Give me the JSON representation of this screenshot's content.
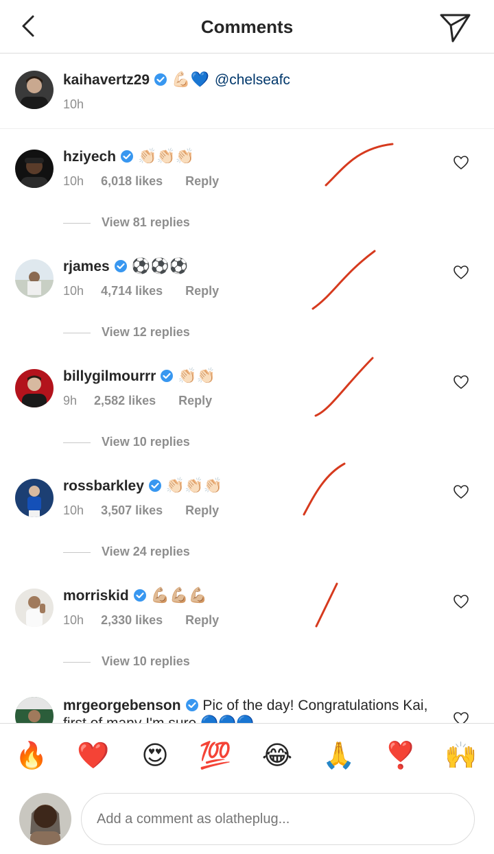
{
  "header": {
    "title": "Comments"
  },
  "caption": {
    "username": "kaihavertz29",
    "emojis": "💪🏻💙",
    "mention": "@chelseafc",
    "time": "10h"
  },
  "comments": [
    {
      "username": "hziyech",
      "emojis": "👏🏻👏🏻👏🏻",
      "time": "10h",
      "likes": "6,018 likes",
      "reply": "Reply",
      "view_replies": "View 81 replies"
    },
    {
      "username": "rjames",
      "emojis": "⚽⚽⚽",
      "time": "10h",
      "likes": "4,714 likes",
      "reply": "Reply",
      "view_replies": "View 12 replies"
    },
    {
      "username": "billygilmourrr",
      "emojis": "👏🏻👏🏻",
      "time": "9h",
      "likes": "2,582 likes",
      "reply": "Reply",
      "view_replies": "View 10 replies"
    },
    {
      "username": "rossbarkley",
      "emojis": "👏🏻👏🏻👏🏻",
      "time": "10h",
      "likes": "3,507 likes",
      "reply": "Reply",
      "view_replies": "View 24 replies"
    },
    {
      "username": "morriskid",
      "emojis": "💪🏼💪🏼💪🏼",
      "time": "10h",
      "likes": "2,330 likes",
      "reply": "Reply",
      "view_replies": "View 10 replies"
    }
  ],
  "partial_comment": {
    "username": "mrgeorgebenson",
    "text": "Pic of the day! Congratulations Kai, first of many I'm sure 🔵🔵🔵"
  },
  "emoji_bar": [
    "🔥",
    "❤️",
    "😍",
    "💯",
    "😂",
    "🙏",
    "❣️",
    "🙌"
  ],
  "composer": {
    "placeholder": "Add a comment as olatheplug..."
  },
  "colors": {
    "verified": "#3897f0",
    "mention": "#00376b",
    "annotation": "#d63a1e",
    "muted": "#8e8e8e"
  },
  "icons": {
    "back": "chevron-left-icon",
    "send": "paper-plane-icon",
    "like": "heart-outline-icon",
    "verified": "verified-badge-icon"
  }
}
